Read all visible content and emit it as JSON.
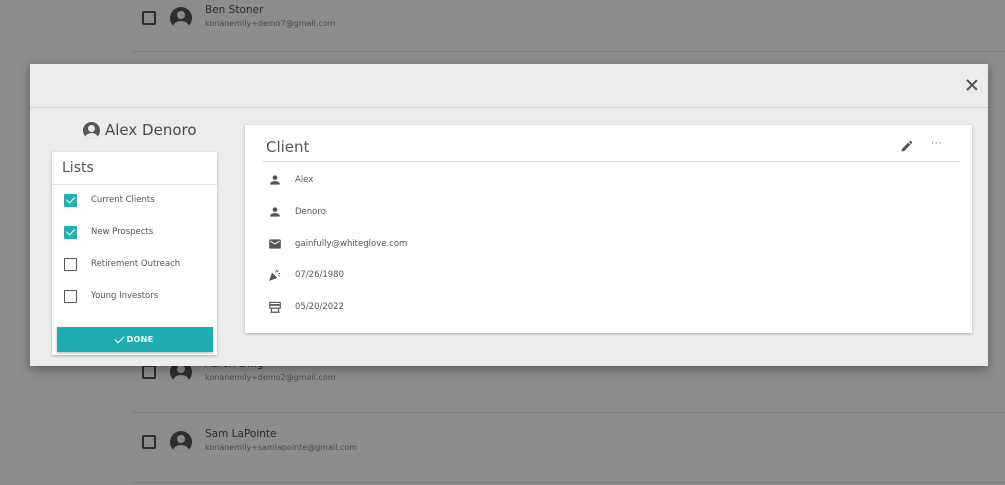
{
  "background_contacts": [
    {
      "name": "Ben Stoner",
      "email": "konanemily+demo7@gmail.com"
    },
    {
      "name": "Aaron Ding",
      "email": "konanemily+demo2@gmail.com"
    },
    {
      "name": "Sam LaPointe",
      "email": "konanemily+samlapointe@gmail.com"
    }
  ],
  "modal": {
    "close_icon": "close-icon",
    "contact_name": "Alex Denoro",
    "lists": {
      "header": "Lists",
      "items": [
        {
          "label": "Current Clients",
          "checked": true
        },
        {
          "label": "New Prospects",
          "checked": true
        },
        {
          "label": "Retirement Outreach",
          "checked": false
        },
        {
          "label": "Young Investors",
          "checked": false
        }
      ],
      "done_label": "DONE"
    },
    "client": {
      "title": "Client",
      "fields": [
        {
          "icon": "person-icon",
          "value": "Alex"
        },
        {
          "icon": "person-icon",
          "value": "Denoro"
        },
        {
          "icon": "email-icon",
          "value": "gainfully@whiteglove.com"
        },
        {
          "icon": "party-popper-icon",
          "value": "07/26/1980"
        },
        {
          "icon": "desk-icon",
          "value": "05/20/2022"
        }
      ]
    }
  },
  "colors": {
    "accent": "#1fadb2",
    "overlay": "#8c8c8c",
    "modal_bg": "#ececec"
  }
}
